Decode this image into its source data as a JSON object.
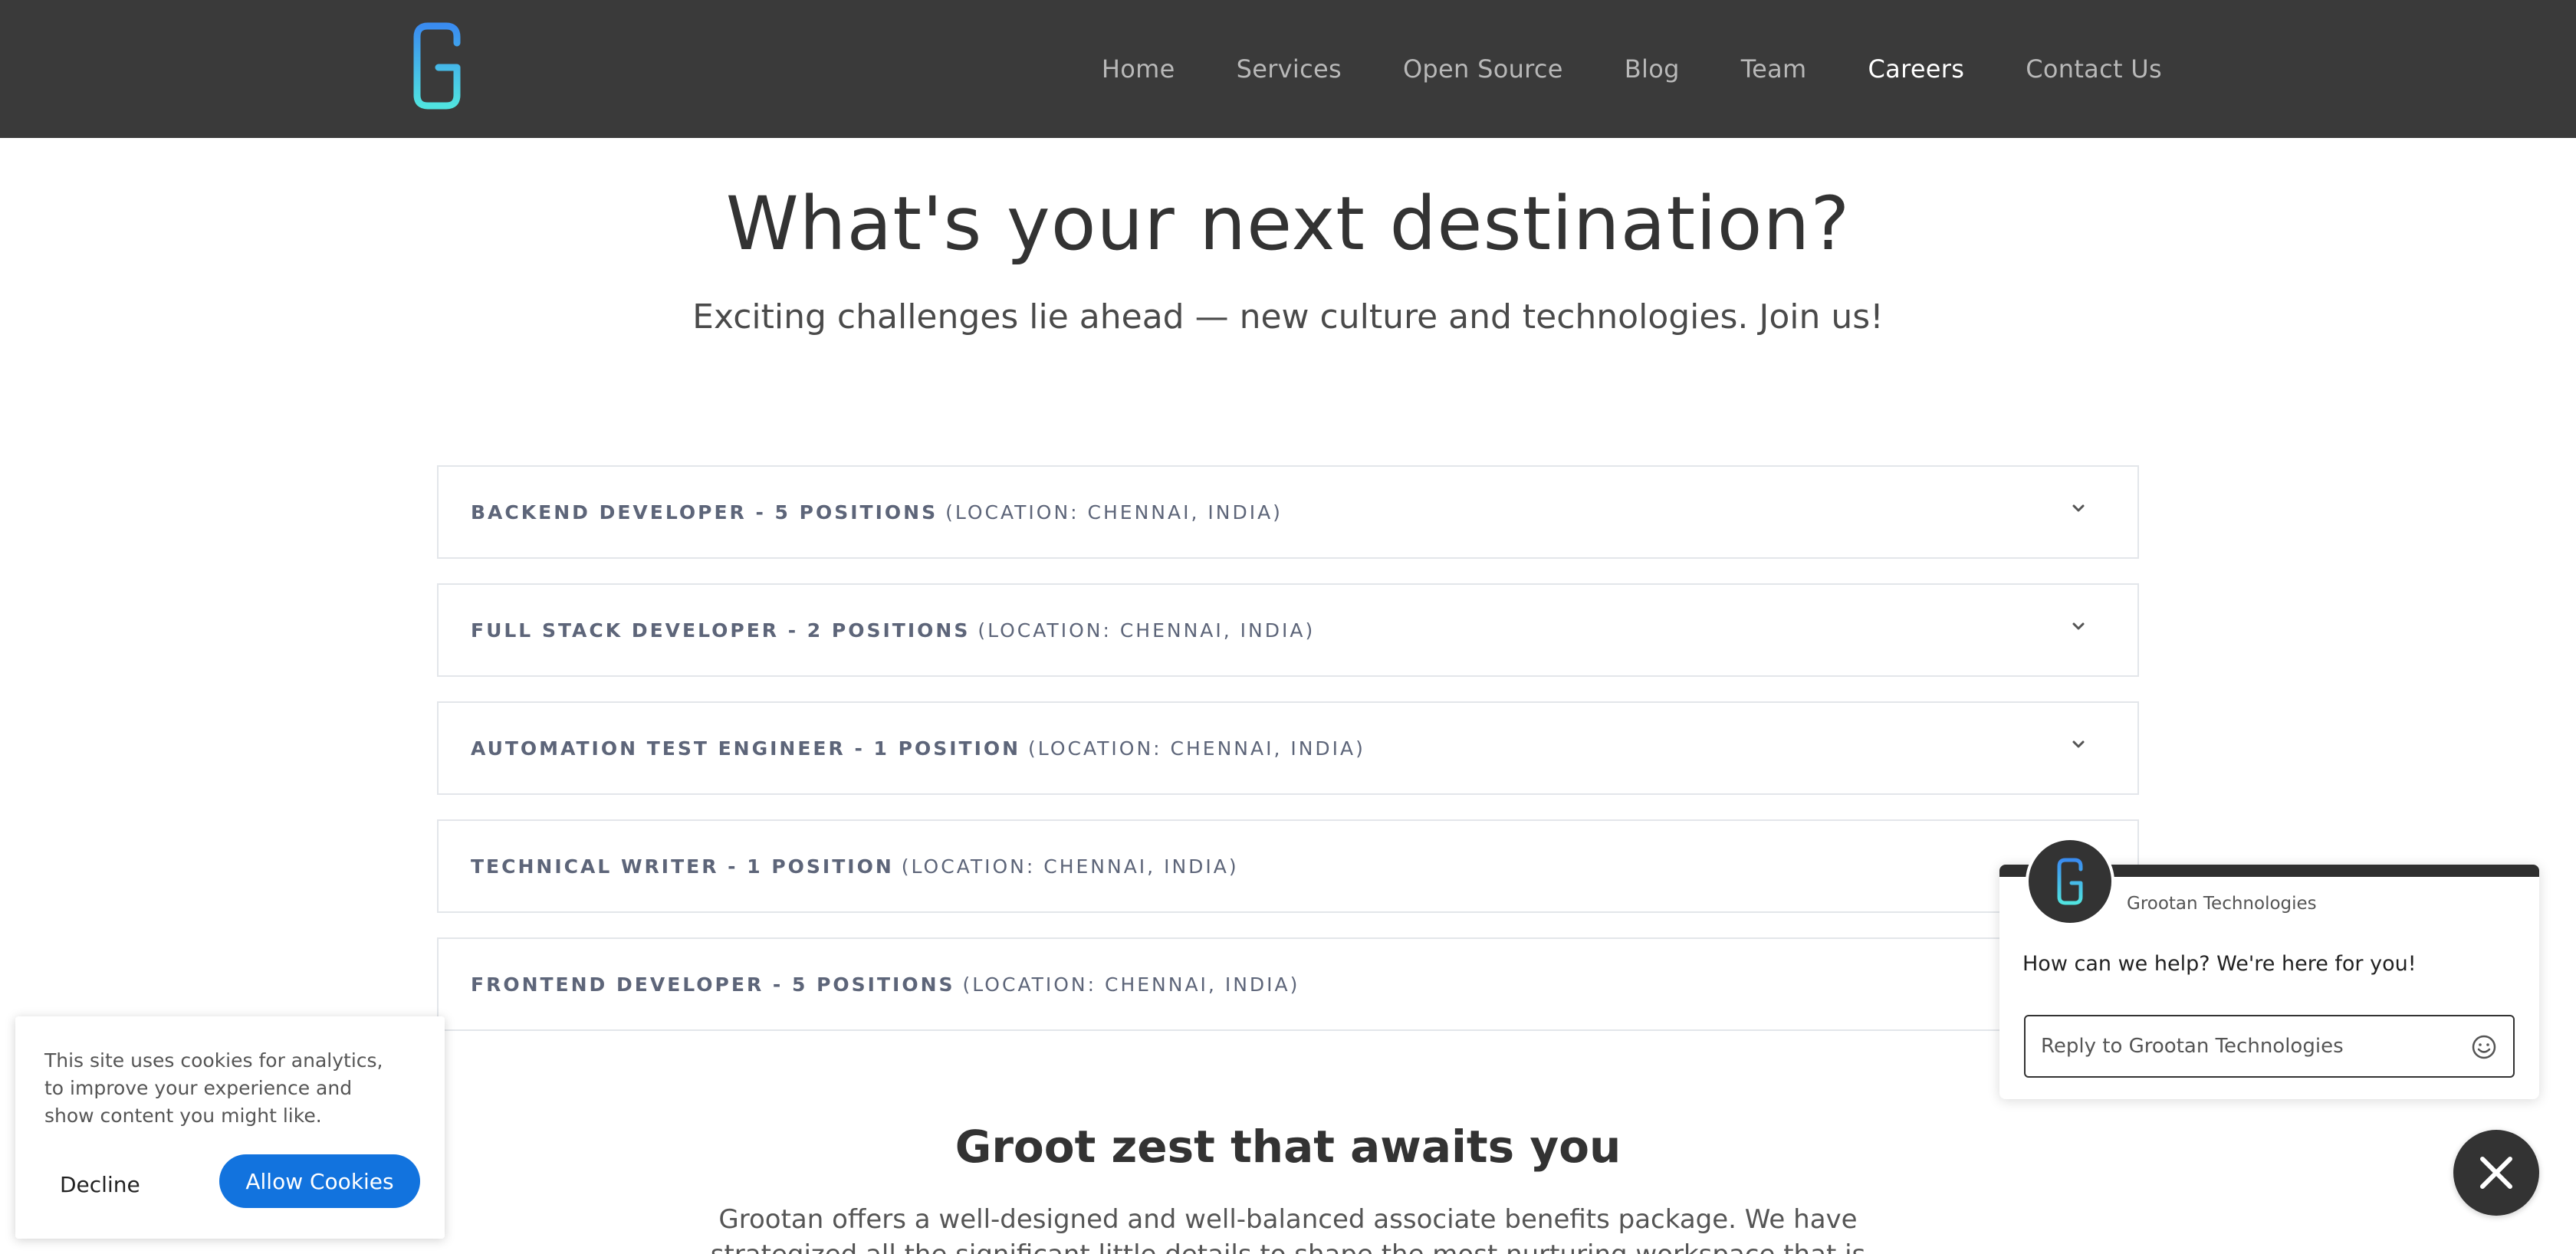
{
  "colors": {
    "header_bg": "#3a3a3a",
    "accent_blue": "#1273de",
    "logo_gradient_top": "#3a8cf0",
    "logo_gradient_bottom": "#50e3e0",
    "text_dark": "#333333",
    "job_text": "#5d6579"
  },
  "header": {
    "logo_icon": "grootan-g-logo",
    "nav": [
      {
        "label": "Home",
        "active": false
      },
      {
        "label": "Services",
        "active": false
      },
      {
        "label": "Open Source",
        "active": false
      },
      {
        "label": "Blog",
        "active": false
      },
      {
        "label": "Team",
        "active": false
      },
      {
        "label": "Careers",
        "active": true
      },
      {
        "label": "Contact Us",
        "active": false
      }
    ]
  },
  "hero": {
    "title": "What's your next destination?",
    "subtitle": "Exciting challenges lie ahead — new culture and technologies. Join us!"
  },
  "jobs": [
    {
      "title": "BACKEND DEVELOPER - 5 POSITIONS",
      "location": "(LOCATION: CHENNAI, INDIA)",
      "icon": "chevron-down-icon"
    },
    {
      "title": "FULL STACK DEVELOPER - 2 POSITIONS",
      "location": "(LOCATION: CHENNAI, INDIA)",
      "icon": "chevron-down-icon"
    },
    {
      "title": "AUTOMATION TEST ENGINEER - 1 POSITION",
      "location": "(LOCATION: CHENNAI, INDIA)",
      "icon": "chevron-down-icon"
    },
    {
      "title": "TECHNICAL WRITER - 1 POSITION",
      "location": "(LOCATION: CHENNAI, INDIA)",
      "icon": "chevron-down-icon"
    },
    {
      "title": "FRONTEND DEVELOPER - 5 POSITIONS",
      "location": "(LOCATION: CHENNAI, INDIA)",
      "icon": "chevron-down-icon"
    }
  ],
  "zest": {
    "title": "Groot zest that awaits you",
    "text_line1": "Grootan offers a well-designed and well-balanced associate benefits package. We have",
    "text_line2": "strategized all the significant little details to shape the most nurturing workspace that is"
  },
  "cookie": {
    "text": "This site uses cookies for analytics, to improve your experience and show content you might like.",
    "decline_label": "Decline",
    "allow_label": "Allow Cookies"
  },
  "chat": {
    "company_name": "Grootan Technologies",
    "message": "How can we help? We're here for you!",
    "input_placeholder": "Reply to Grootan Technologies",
    "emoji_icon": "emoji-smile-icon",
    "close_icon": "close-icon"
  }
}
